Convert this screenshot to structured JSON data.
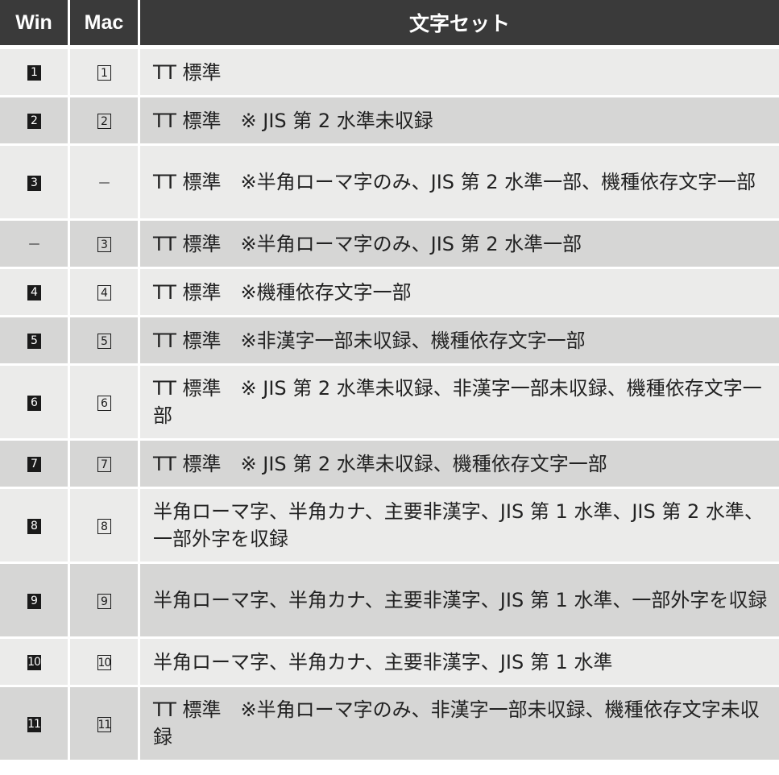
{
  "header": {
    "win": "Win",
    "mac": "Mac",
    "charset": "文字セット"
  },
  "rows": [
    {
      "win": "1",
      "mac": "1",
      "text": "TT 標準"
    },
    {
      "win": "2",
      "mac": "2",
      "text": "TT 標準　※ JIS 第 2 水準未収録"
    },
    {
      "win": "3",
      "mac": "—",
      "text": "TT 標準　※半角ローマ字のみ、JIS 第 2 水準一部、機種依存文字一部"
    },
    {
      "win": "—",
      "mac": "3",
      "text": "TT 標準　※半角ローマ字のみ、JIS 第 2 水準一部"
    },
    {
      "win": "4",
      "mac": "4",
      "text": "TT 標準　※機種依存文字一部"
    },
    {
      "win": "5",
      "mac": "5",
      "text": "TT 標準　※非漢字一部未収録、機種依存文字一部"
    },
    {
      "win": "6",
      "mac": "6",
      "text": "TT 標準　※ JIS 第 2 水準未収録、非漢字一部未収録、機種依存文字一部"
    },
    {
      "win": "7",
      "mac": "7",
      "text": "TT 標準　※ JIS 第 2 水準未収録、機種依存文字一部"
    },
    {
      "win": "8",
      "mac": "8",
      "text": "半角ローマ字、半角カナ、主要非漢字、JIS 第 1 水準、JIS 第 2 水準、一部外字を収録"
    },
    {
      "win": "9",
      "mac": "9",
      "text": "半角ローマ字、半角カナ、主要非漢字、JIS 第 1 水準、一部外字を収録"
    },
    {
      "win": "10",
      "mac": "10",
      "text": "半角ローマ字、半角カナ、主要非漢字、JIS 第 1 水準"
    },
    {
      "win": "11",
      "mac": "11",
      "text": "TT 標準　※半角ローマ字のみ、非漢字一部未収録、機種依存文字未収録"
    }
  ],
  "style": {
    "header_bg": "#3a3a3a",
    "row_light": "#ebebea",
    "row_dark": "#d6d6d5",
    "win_marker": "filled-black-square",
    "mac_marker": "outlined-square",
    "missing_marker": "em-dash"
  }
}
